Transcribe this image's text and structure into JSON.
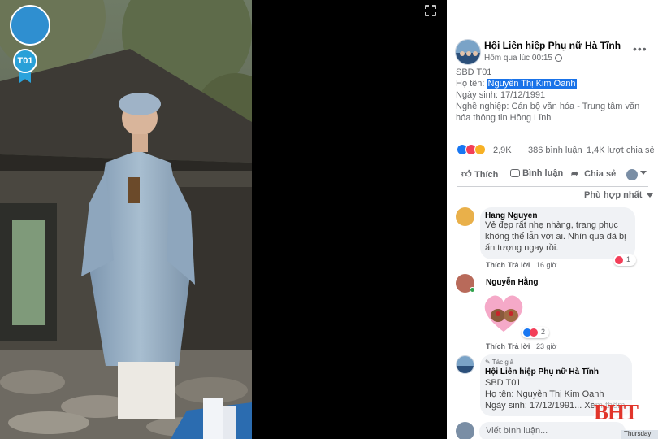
{
  "viewer": {
    "photo_badge": "T01",
    "watermark": "BHT"
  },
  "post": {
    "page_name": "Hội Liên hiệp Phụ nữ Hà Tĩnh",
    "time": "Hôm qua lúc 00:15 ·",
    "lines": [
      "SBD T01",
      "Họ tên: ",
      "Ngày sinh: 17/12/1991",
      "Nghề nghiệp: Cán bộ văn hóa - Trung tâm văn",
      "hóa thông tin Hồng Lĩnh"
    ],
    "highlight_name": "Nguyễn Thị Kim Oanh",
    "reactions_count": "2,9K",
    "comments_count": "386 bình luận",
    "shares_count": "1,4K lượt chia sẻ",
    "actions": {
      "like": "Thích",
      "comment": "Bình luận",
      "share": "Chia sẻ"
    },
    "sort_label": "Phù hợp nhất"
  },
  "comments": [
    {
      "author": "Hang Nguyen",
      "lines": [
        "Vẻ đẹp rất nhẹ nhàng, trang phục",
        "không thể lẫn với ai. Nhìn qua đã bị",
        "ấn tượng ngay rồi."
      ],
      "like": "Thích",
      "reply": "Trả lời",
      "time": "16 giờ",
      "reactions": "1"
    },
    {
      "author": "Nguyễn Hằng",
      "like": "Thích",
      "reply": "Trả lời",
      "time": "23 giờ",
      "reactions": "2"
    },
    {
      "author_tag": "Tác giả",
      "author": "Hội Liên hiệp Phụ nữ Hà Tĩnh",
      "lines": [
        "SBD T01",
        "Họ tên: Nguyễn Thị Kim Oanh",
        "Ngày sinh: 17/12/1991... Xem thêm"
      ]
    }
  ],
  "composer": {
    "placeholder": "Viết bình luận..."
  },
  "taskbar": {
    "day": "Thursday"
  },
  "colors": {
    "link_blue": "#1877f2",
    "highlight": "#1a73e8",
    "muted": "#65676b",
    "bubble": "#f0f2f5"
  }
}
